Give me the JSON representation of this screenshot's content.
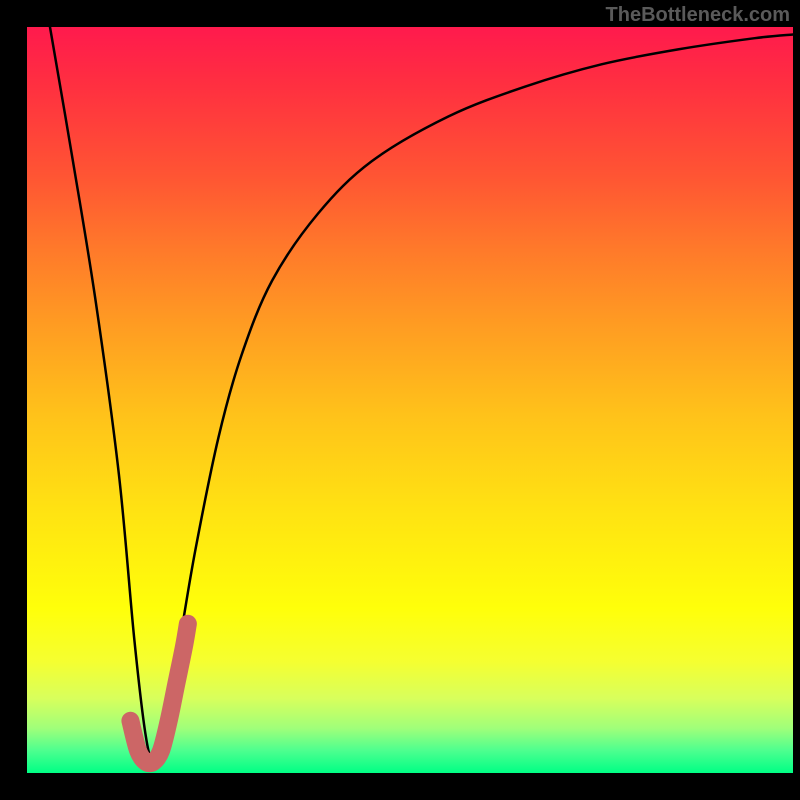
{
  "watermark": "TheBottleneck.com",
  "chart_data": {
    "type": "line",
    "title": "",
    "xlabel": "",
    "ylabel": "",
    "xlim": [
      0,
      100
    ],
    "ylim": [
      0,
      100
    ],
    "series": [
      {
        "name": "bottleneck-curve",
        "color": "#000000",
        "x": [
          3,
          6,
          9,
          12,
          14,
          15.5,
          16.5,
          18,
          20,
          22,
          25,
          28,
          32,
          38,
          45,
          55,
          65,
          75,
          85,
          95,
          100
        ],
        "values": [
          100,
          82,
          63,
          40,
          18,
          5,
          2,
          6,
          18,
          30,
          45,
          56,
          66,
          75,
          82,
          88,
          92,
          95,
          97,
          98.5,
          99
        ]
      },
      {
        "name": "highlight-segment",
        "color": "#cc6666",
        "x": [
          13.5,
          14.5,
          15.5,
          16.5,
          17.5,
          18.5,
          19.5,
          20.5,
          21
        ],
        "values": [
          7,
          3,
          1.5,
          1.5,
          3,
          7,
          12,
          17,
          20
        ]
      }
    ],
    "gradient_background": {
      "top": "#ff1a4d",
      "middle": "#ffe312",
      "bottom": "#00ff85"
    }
  }
}
